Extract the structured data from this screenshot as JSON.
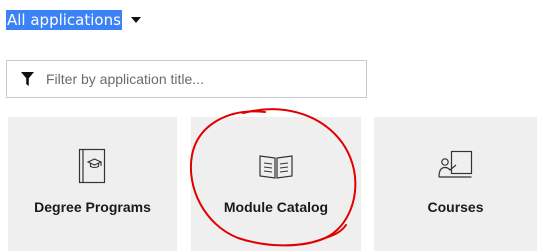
{
  "header": {
    "title": "All applications",
    "dropdown_icon": "caret-down-icon"
  },
  "filter": {
    "placeholder": "Filter by application title...",
    "value": "",
    "icon": "filter-icon"
  },
  "tiles": [
    {
      "label": "Degree Programs",
      "icon": "graduation-cap-book-icon"
    },
    {
      "label": "Module Catalog",
      "icon": "open-book-icon"
    },
    {
      "label": "Courses",
      "icon": "presentation-board-icon"
    }
  ],
  "colors": {
    "title_highlight": "#3b82f6",
    "tile_background": "#efefef",
    "annotation_circle": "#e00000"
  }
}
